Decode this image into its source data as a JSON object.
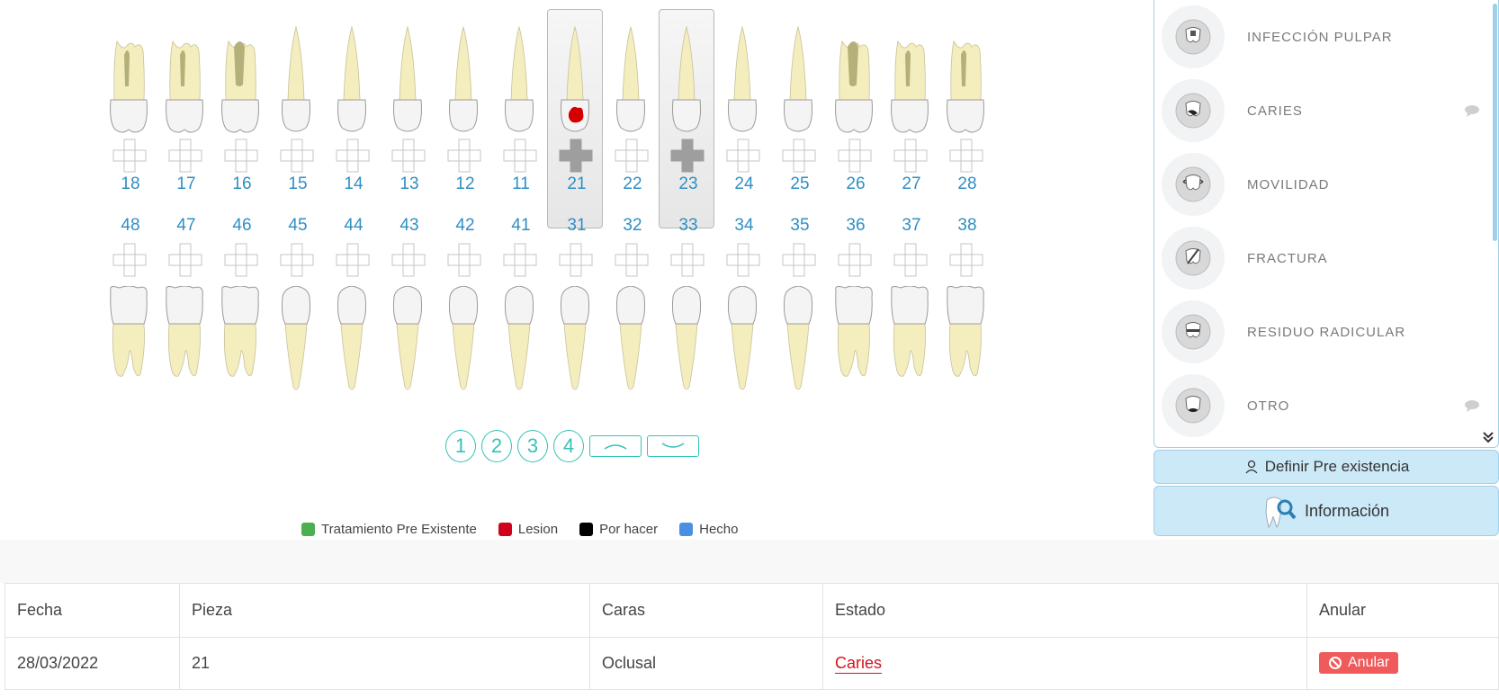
{
  "odontogram": {
    "upper_numbers": [
      "18",
      "17",
      "16",
      "15",
      "14",
      "13",
      "12",
      "11",
      "21",
      "22",
      "23",
      "24",
      "25",
      "26",
      "27",
      "28"
    ],
    "lower_numbers": [
      "48",
      "47",
      "46",
      "45",
      "44",
      "43",
      "42",
      "41",
      "31",
      "32",
      "33",
      "34",
      "35",
      "36",
      "37",
      "38"
    ],
    "selected": [
      "21",
      "23"
    ]
  },
  "pager": {
    "pages": [
      "1",
      "2",
      "3",
      "4"
    ]
  },
  "legend": [
    {
      "label": "Tratamiento Pre Existente",
      "color": "#4caf50"
    },
    {
      "label": "Lesion",
      "color": "#d0021b"
    },
    {
      "label": "Por hacer",
      "color": "#000000"
    },
    {
      "label": "Hecho",
      "color": "#4a90e2"
    }
  ],
  "panel": {
    "items": [
      {
        "label": "INFECCIÓN PULPAR",
        "icon": "pulp-infection-icon"
      },
      {
        "label": "CARIES",
        "icon": "caries-icon"
      },
      {
        "label": "MOVILIDAD",
        "icon": "mobility-icon"
      },
      {
        "label": "FRACTURA",
        "icon": "fracture-icon"
      },
      {
        "label": "RESIDUO RADICULAR",
        "icon": "root-residue-icon"
      },
      {
        "label": "OTRO",
        "icon": "other-icon"
      }
    ],
    "define_button": "Definir Pre existencia",
    "info_button": "Información"
  },
  "history": {
    "headers": [
      "Fecha",
      "Pieza",
      "Caras",
      "Estado",
      "Anular"
    ],
    "rows": [
      {
        "fecha": "28/03/2022",
        "pieza": "21",
        "caras": "Oclusal",
        "estado": "Caries",
        "anular": "Anular"
      }
    ]
  },
  "colors": {
    "accent": "#34c3b6",
    "number_blue": "#2f8fc4",
    "panel_button_bg": "#cce9f7",
    "lesion_red": "#d3121c",
    "anular_red": "#f05a5a"
  }
}
